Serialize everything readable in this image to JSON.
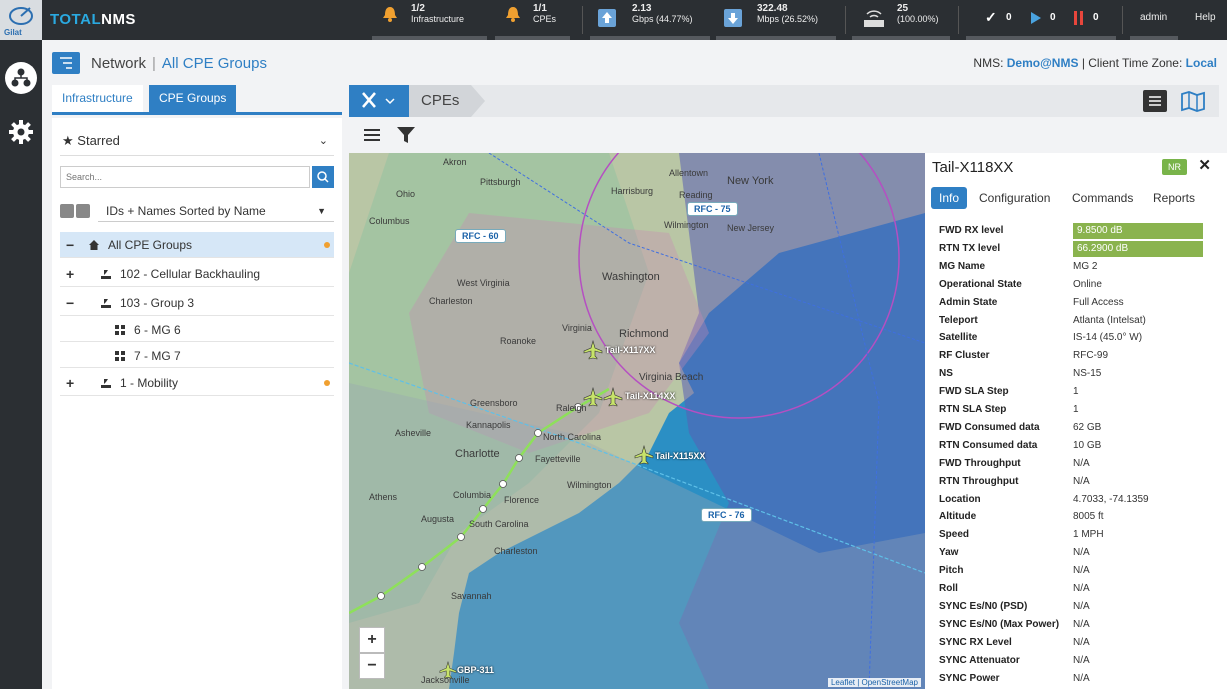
{
  "app": {
    "brand_part1": "TOTAL",
    "brand_part2": "NMS",
    "logo_text": "Gilat"
  },
  "topbar": {
    "infra_alarm_value": "1/2",
    "infra_alarm_label": "Infrastructure",
    "cpe_alarm_value": "1/1",
    "cpe_alarm_label": "CPEs",
    "fwd_icon": "FWD",
    "fwd_value": "2.13",
    "fwd_detail": "Gbps (44.77%)",
    "rtn_icon": "RTN",
    "rtn_value": "322.48",
    "rtn_detail": "Mbps (26.52%)",
    "terminals_value": "25",
    "terminals_detail": "(100.00%)",
    "ok_count": "0",
    "play_count": "0",
    "pause_count": "0",
    "user": "admin",
    "help": "Help"
  },
  "header": {
    "breadcrumb_root": "Network",
    "breadcrumb_current": "All CPE Groups",
    "nms_label": "NMS:",
    "nms_value": "Demo@NMS",
    "tz_label": "| Client Time Zone:",
    "tz_value": "Local"
  },
  "left_panel": {
    "tab_infrastructure": "Infrastructure",
    "tab_cpe_groups": "CPE Groups",
    "starred": "Starred",
    "search_placeholder": "Search...",
    "sort_option": "IDs + Names Sorted by Name",
    "tree": [
      {
        "toggle": "−",
        "label": "All CPE Groups"
      },
      {
        "toggle": "+",
        "label": "102 - Cellular Backhauling"
      },
      {
        "toggle": "−",
        "label": "103 - Group 3"
      },
      {
        "toggle": "",
        "label": "6 - MG 6"
      },
      {
        "toggle": "",
        "label": "7 - MG 7"
      },
      {
        "toggle": "+",
        "label": "1 - Mobility"
      }
    ]
  },
  "cpe_panel": {
    "title": "CPEs"
  },
  "map": {
    "rfc_labels": [
      "RFC - 60",
      "RFC - 75",
      "RFC - 76"
    ],
    "city_labels": [
      "Akron",
      "Pittsburgh",
      "Allentown",
      "New York",
      "Ohio",
      "Harrisburg",
      "Reading",
      "Columbus",
      "Wilmington",
      "New Jersey",
      "West Virginia",
      "Washington",
      "Charleston",
      "Virginia",
      "Richmond",
      "Roanoke",
      "Virginia Beach",
      "Greensboro",
      "Raleigh",
      "Kannapolis",
      "Asheville",
      "North Carolina",
      "Charlotte",
      "Fayetteville",
      "Wilmington",
      "Athens",
      "Columbia",
      "Florence",
      "Augusta",
      "South Carolina",
      "Charleston",
      "Savannah",
      "Jacksonville"
    ],
    "planes": [
      "Tail-X117XX",
      "Tail-X114XX",
      "Tail-X115XX",
      "GBP-311"
    ],
    "zoom_in": "+",
    "zoom_out": "−",
    "attribution": "Leaflet | OpenStreetMap"
  },
  "details": {
    "title": "Tail-X118XX",
    "badge": "NR",
    "close": "✕",
    "tabs": [
      "Info",
      "Configuration",
      "Commands",
      "Reports"
    ],
    "rows": [
      {
        "k": "FWD RX level",
        "v": "9.8500 dB"
      },
      {
        "k": "RTN TX level",
        "v": "66.2900 dB"
      },
      {
        "k": "MG Name",
        "v": "MG 2"
      },
      {
        "k": "Operational State",
        "v": "Online"
      },
      {
        "k": "Admin State",
        "v": "Full Access"
      },
      {
        "k": "Teleport",
        "v": "Atlanta (Intelsat)"
      },
      {
        "k": "Satellite",
        "v": "IS-14 (45.0° W)"
      },
      {
        "k": "RF Cluster",
        "v": "RFC-99"
      },
      {
        "k": "NS",
        "v": "NS-15"
      },
      {
        "k": "FWD SLA Step",
        "v": "1"
      },
      {
        "k": "RTN SLA Step",
        "v": "1"
      },
      {
        "k": "FWD Consumed data",
        "v": "62 GB"
      },
      {
        "k": "RTN Consumed data",
        "v": "10 GB"
      },
      {
        "k": "FWD Throughput",
        "v": "N/A"
      },
      {
        "k": "RTN Throughput",
        "v": "N/A"
      },
      {
        "k": "Location",
        "v": "4.7033,   -74.1359"
      },
      {
        "k": "Altitude",
        "v": "8005 ft"
      },
      {
        "k": "Speed",
        "v": "1 MPH"
      },
      {
        "k": "Yaw",
        "v": "N/A"
      },
      {
        "k": "Pitch",
        "v": "N/A"
      },
      {
        "k": "Roll",
        "v": "N/A"
      },
      {
        "k": "SYNC Es/N0 (PSD)",
        "v": "N/A"
      },
      {
        "k": "SYNC Es/N0 (Max Power)",
        "v": "N/A"
      },
      {
        "k": "SYNC RX Level",
        "v": "N/A"
      },
      {
        "k": "SYNC Attenuator",
        "v": "N/A"
      },
      {
        "k": "SYNC Power",
        "v": "N/A"
      }
    ]
  },
  "colors": {
    "accent": "#2f7fc4",
    "topbar": "#2b2f33",
    "level_bar": "#8ab34e",
    "alarm": "#f0a030",
    "pause": "#e8463c"
  }
}
